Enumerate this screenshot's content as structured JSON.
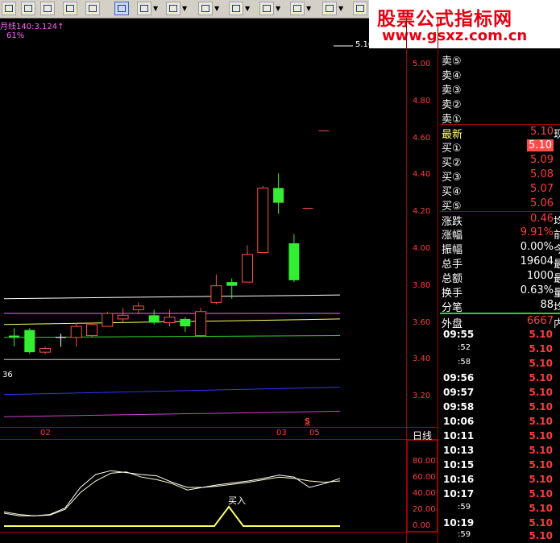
{
  "toolbar": {
    "tools": [
      "table-icon",
      "chart-icon",
      "line-chart-icon",
      "window-icon",
      "print-icon",
      "pen-icon",
      "line-icon",
      "text-icon",
      "bars-icon",
      "fan-icon",
      "channel-icon",
      "parallel-icon",
      "rect-icon",
      "circle-icon"
    ]
  },
  "watermark": {
    "title": "股票公式指标网",
    "url": "www.gsxz.com.cn"
  },
  "chart": {
    "ma_label": "月线140:3.124↑",
    "pct_label": "61%",
    "last_price_label": "5.10",
    "left_edge_label": "36",
    "y_ticks": [
      "5.00",
      "4.80",
      "4.60",
      "4.40",
      "4.20",
      "4.00",
      "3.80",
      "3.60",
      "3.40",
      "3.20"
    ],
    "x_labels": [
      "02",
      "03",
      "05"
    ],
    "period_label": "日线",
    "s_marker": "S",
    "sub_y_ticks": [
      "80.00",
      "60.00",
      "40.00",
      "20.00",
      "0.00"
    ],
    "buy_label": "买入"
  },
  "chart_data": {
    "type": "candlestick",
    "ylim": [
      3.1,
      5.1
    ],
    "candles": [
      {
        "o": 3.53,
        "c": 3.52,
        "h": 3.57,
        "l": 3.47,
        "dir": "down"
      },
      {
        "o": 3.56,
        "c": 3.44,
        "h": 3.57,
        "l": 3.43,
        "dir": "down"
      },
      {
        "o": 3.44,
        "c": 3.46,
        "h": 3.47,
        "l": 3.43,
        "dir": "up"
      },
      {
        "o": 3.52,
        "c": 3.52,
        "h": 3.54,
        "l": 3.47,
        "dir": "flat"
      },
      {
        "o": 3.52,
        "c": 3.58,
        "h": 3.6,
        "l": 3.47,
        "dir": "up"
      },
      {
        "o": 3.53,
        "c": 3.59,
        "h": 3.6,
        "l": 3.52,
        "dir": "up"
      },
      {
        "o": 3.58,
        "c": 3.65,
        "h": 3.66,
        "l": 3.58,
        "dir": "up"
      },
      {
        "o": 3.62,
        "c": 3.64,
        "h": 3.68,
        "l": 3.6,
        "dir": "up"
      },
      {
        "o": 3.67,
        "c": 3.69,
        "h": 3.71,
        "l": 3.65,
        "dir": "up"
      },
      {
        "o": 3.64,
        "c": 3.6,
        "h": 3.67,
        "l": 3.59,
        "dir": "down"
      },
      {
        "o": 3.6,
        "c": 3.63,
        "h": 3.67,
        "l": 3.58,
        "dir": "up"
      },
      {
        "o": 3.62,
        "c": 3.58,
        "h": 3.63,
        "l": 3.55,
        "dir": "down"
      },
      {
        "o": 3.53,
        "c": 3.66,
        "h": 3.68,
        "l": 3.52,
        "dir": "up"
      },
      {
        "o": 3.71,
        "c": 3.8,
        "h": 3.86,
        "l": 3.7,
        "dir": "up"
      },
      {
        "o": 3.82,
        "c": 3.8,
        "h": 3.84,
        "l": 3.73,
        "dir": "down"
      },
      {
        "o": 3.82,
        "c": 3.97,
        "h": 4.02,
        "l": 3.82,
        "dir": "up"
      },
      {
        "o": 3.98,
        "c": 4.33,
        "h": 4.34,
        "l": 3.98,
        "dir": "up"
      },
      {
        "o": 4.33,
        "c": 4.25,
        "h": 4.41,
        "l": 4.19,
        "dir": "down"
      },
      {
        "o": 4.03,
        "c": 3.83,
        "h": 4.08,
        "l": 3.82,
        "dir": "down"
      },
      {
        "o": 4.22,
        "c": 4.22,
        "h": 4.22,
        "l": 4.22,
        "dir": "flat"
      },
      {
        "o": 4.64,
        "c": 4.64,
        "h": 4.64,
        "l": 4.64,
        "dir": "flat"
      }
    ],
    "lines": [
      {
        "name": "ma-white",
        "color": "#ffffff",
        "y0": 3.73,
        "y1": 3.75
      },
      {
        "name": "ma-yellow",
        "color": "#ffff66",
        "y0": 3.59,
        "y1": 3.62
      },
      {
        "name": "ma-magenta",
        "color": "#ff66ff",
        "y0": 3.65,
        "y1": 3.65
      },
      {
        "name": "ma-green",
        "color": "#33cc33",
        "y0": 3.52,
        "y1": 3.53
      },
      {
        "name": "ma-gray",
        "color": "#cccccc",
        "y0": 3.4,
        "y1": 3.4
      },
      {
        "name": "ma-blue",
        "color": "#3333ff",
        "y0": 3.21,
        "y1": 3.25
      },
      {
        "name": "ma-purple",
        "color": "#cc44cc",
        "y0": 3.09,
        "y1": 3.12
      }
    ],
    "osc": {
      "ylim": [
        0,
        100
      ],
      "white": [
        20,
        16,
        16,
        18,
        28,
        60,
        80,
        86,
        83,
        80,
        78,
        68,
        60,
        60,
        64,
        67,
        70,
        74,
        79,
        76,
        60,
        66,
        74
      ],
      "yellow": [
        22,
        18,
        16,
        17,
        26,
        52,
        70,
        82,
        84,
        76,
        72,
        66,
        56,
        60,
        62,
        65,
        68,
        72,
        76,
        74,
        70,
        68,
        70
      ]
    },
    "buy_signal": {
      "x_index": 14,
      "value": 30
    }
  },
  "quote": {
    "rows": [
      {
        "label": "卖⑤",
        "value": "",
        "extra": ""
      },
      {
        "label": "卖④",
        "value": "",
        "extra": ""
      },
      {
        "label": "卖③",
        "value": "",
        "extra": ""
      },
      {
        "label": "卖②",
        "value": "",
        "extra": ""
      },
      {
        "label": "卖①",
        "value": "",
        "extra": ""
      },
      {
        "label": "最新",
        "value": "5.10",
        "extra": "现"
      },
      {
        "label": "买①",
        "value": "5.10",
        "extra": ""
      },
      {
        "label": "买②",
        "value": "5.09",
        "extra": ""
      },
      {
        "label": "买③",
        "value": "5.08",
        "extra": ""
      },
      {
        "label": "买④",
        "value": "5.07",
        "extra": ""
      },
      {
        "label": "买⑤",
        "value": "5.06",
        "extra": ""
      },
      {
        "label": "涨跌",
        "value": "0.46",
        "extra": "均"
      },
      {
        "label": "涨幅",
        "value": "9.91%",
        "extra": "前"
      },
      {
        "label": "振幅",
        "value": "0.00%",
        "extra": "今"
      },
      {
        "label": "总手",
        "value": "19604",
        "extra": "最"
      },
      {
        "label": "总额",
        "value": "1000",
        "extra": "最"
      },
      {
        "label": "换手",
        "value": "0.63%",
        "extra": "量"
      },
      {
        "label": "分笔",
        "value": "88",
        "extra": "均"
      },
      {
        "label": "外盘",
        "value": "6667",
        "extra": "内"
      }
    ]
  },
  "ticks": [
    {
      "time": "09:55",
      "price": "5.10"
    },
    {
      "time": ":52",
      "price": "5.10"
    },
    {
      "time": ":58",
      "price": "5.10"
    },
    {
      "time": "09:56",
      "price": "5.10"
    },
    {
      "time": "09:57",
      "price": "5.10"
    },
    {
      "time": "09:58",
      "price": "5.10"
    },
    {
      "time": "10:06",
      "price": "5.10"
    },
    {
      "time": "10:11",
      "price": "5.10"
    },
    {
      "time": "10:13",
      "price": "5.10"
    },
    {
      "time": "10:15",
      "price": "5.10"
    },
    {
      "time": "10:16",
      "price": "5.10"
    },
    {
      "time": "10:17",
      "price": "5.10"
    },
    {
      "time": ":59",
      "price": "5.10"
    },
    {
      "time": "10:19",
      "price": "5.10"
    },
    {
      "time": ":59",
      "price": "5.10"
    }
  ]
}
